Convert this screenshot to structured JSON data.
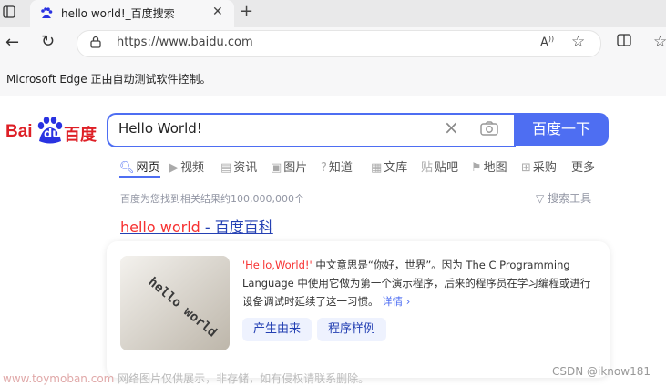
{
  "browser": {
    "tab_title": "hello world!_百度搜索",
    "url": "https://www.baidu.com",
    "infobar_text": "Microsoft Edge 正由自动测试软件控制。"
  },
  "baidu": {
    "logo_bai": "Bai",
    "logo_du": "du",
    "logo_cn": "百度",
    "query": "Hello World!",
    "search_button": "百度一下",
    "tabs": [
      {
        "label": "网页",
        "icon": "search-icon"
      },
      {
        "label": "视频",
        "icon": "video-icon"
      },
      {
        "label": "资讯",
        "icon": "news-icon"
      },
      {
        "label": "图片",
        "icon": "image-icon"
      },
      {
        "label": "知道",
        "icon": "question-icon"
      },
      {
        "label": "文库",
        "icon": "book-icon"
      },
      {
        "label": "贴吧",
        "icon": "tieba-icon"
      },
      {
        "label": "地图",
        "icon": "map-icon"
      },
      {
        "label": "采购",
        "icon": "cart-icon"
      },
      {
        "label": "更多",
        "icon": ""
      }
    ],
    "result_count": "百度为您找到相关结果约100,000,000个",
    "search_tools": "搜索工具",
    "result": {
      "title_em": "hello world",
      "title_rest": " - 百度百科",
      "desc_em": "'Hello,World!'",
      "desc_rest": " 中文意思是“你好，世界”。因为 The C Programming Language 中使用它做为第一个演示程序，后来的程序员在学习编程或进行设备调试时延续了这一习惯。",
      "more": "详情 ›",
      "chips": [
        "产生由来",
        "程序样例"
      ],
      "thumb_text": "hello world"
    }
  },
  "overlay": {
    "watermark_brand": "www.toymoban.com",
    "watermark_text": " 网络图片仅供展示，非存储，如有侵权请联系删除。",
    "csdn": "CSDN @iknow181"
  }
}
